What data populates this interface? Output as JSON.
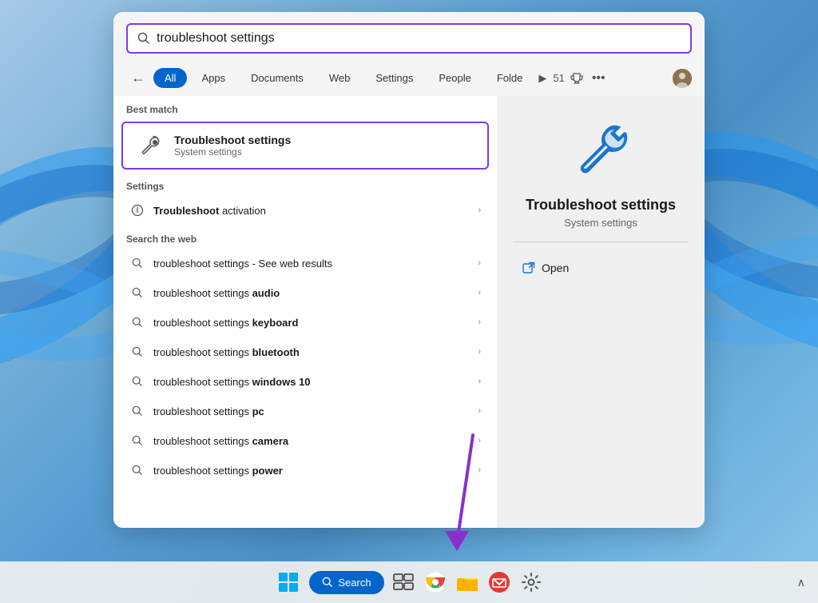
{
  "desktop": {
    "background": "Windows 11 desktop with blue swirl"
  },
  "search": {
    "input_value": "troubleshoot settings",
    "input_placeholder": "Search"
  },
  "filter_tabs": {
    "back_label": "←",
    "tabs": [
      {
        "id": "all",
        "label": "All",
        "active": true
      },
      {
        "id": "apps",
        "label": "Apps",
        "active": false
      },
      {
        "id": "documents",
        "label": "Documents",
        "active": false
      },
      {
        "id": "web",
        "label": "Web",
        "active": false
      },
      {
        "id": "settings",
        "label": "Settings",
        "active": false
      },
      {
        "id": "people",
        "label": "People",
        "active": false
      },
      {
        "id": "folders",
        "label": "Folde",
        "active": false
      }
    ],
    "count": "51",
    "more_label": "•••"
  },
  "results": {
    "best_match_label": "Best match",
    "best_match": {
      "title": "Troubleshoot settings",
      "subtitle": "System settings"
    },
    "settings_section_label": "Settings",
    "settings_items": [
      {
        "label_normal": "Troubleshoot",
        "label_bold": " activation"
      }
    ],
    "web_section_label": "Search the web",
    "web_items": [
      {
        "label_normal": "troubleshoot settings",
        "label_bold": "",
        "suffix": " - See web results"
      },
      {
        "label_normal": "troubleshoot settings ",
        "label_bold": "audio",
        "suffix": ""
      },
      {
        "label_normal": "troubleshoot settings ",
        "label_bold": "keyboard",
        "suffix": ""
      },
      {
        "label_normal": "troubleshoot settings ",
        "label_bold": "bluetooth",
        "suffix": ""
      },
      {
        "label_normal": "troubleshoot settings ",
        "label_bold": "windows 10",
        "suffix": ""
      },
      {
        "label_normal": "troubleshoot settings ",
        "label_bold": "pc",
        "suffix": ""
      },
      {
        "label_normal": "troubleshoot settings ",
        "label_bold": "camera",
        "suffix": ""
      },
      {
        "label_normal": "troubleshoot settings ",
        "label_bold": "power",
        "suffix": ""
      }
    ]
  },
  "detail": {
    "title": "Troubleshoot settings",
    "subtitle": "System settings",
    "open_label": "Open"
  },
  "taskbar": {
    "search_label": "Search",
    "chevron_up": "∧"
  }
}
